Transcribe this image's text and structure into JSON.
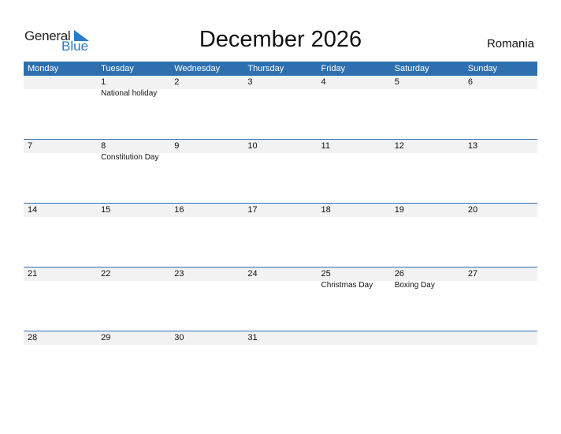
{
  "logo": {
    "general": "General",
    "blue": "Blue"
  },
  "title": "December 2026",
  "country": "Romania",
  "colors": {
    "accent": "#2e6fb0",
    "logo_blue": "#2a7bc8",
    "day_bar": "#f2f2f2"
  },
  "weekdays": [
    "Monday",
    "Tuesday",
    "Wednesday",
    "Thursday",
    "Friday",
    "Saturday",
    "Sunday"
  ],
  "weeks": [
    [
      {
        "day": ""
      },
      {
        "day": "1",
        "holiday": "National holiday"
      },
      {
        "day": "2"
      },
      {
        "day": "3"
      },
      {
        "day": "4"
      },
      {
        "day": "5"
      },
      {
        "day": "6"
      }
    ],
    [
      {
        "day": "7"
      },
      {
        "day": "8",
        "holiday": "Constitution Day"
      },
      {
        "day": "9"
      },
      {
        "day": "10"
      },
      {
        "day": "11"
      },
      {
        "day": "12"
      },
      {
        "day": "13"
      }
    ],
    [
      {
        "day": "14"
      },
      {
        "day": "15"
      },
      {
        "day": "16"
      },
      {
        "day": "17"
      },
      {
        "day": "18"
      },
      {
        "day": "19"
      },
      {
        "day": "20"
      }
    ],
    [
      {
        "day": "21"
      },
      {
        "day": "22"
      },
      {
        "day": "23"
      },
      {
        "day": "24"
      },
      {
        "day": "25",
        "holiday": "Christmas Day"
      },
      {
        "day": "26",
        "holiday": "Boxing Day"
      },
      {
        "day": "27"
      }
    ],
    [
      {
        "day": "28"
      },
      {
        "day": "29"
      },
      {
        "day": "30"
      },
      {
        "day": "31"
      },
      {
        "day": ""
      },
      {
        "day": ""
      },
      {
        "day": ""
      }
    ]
  ]
}
